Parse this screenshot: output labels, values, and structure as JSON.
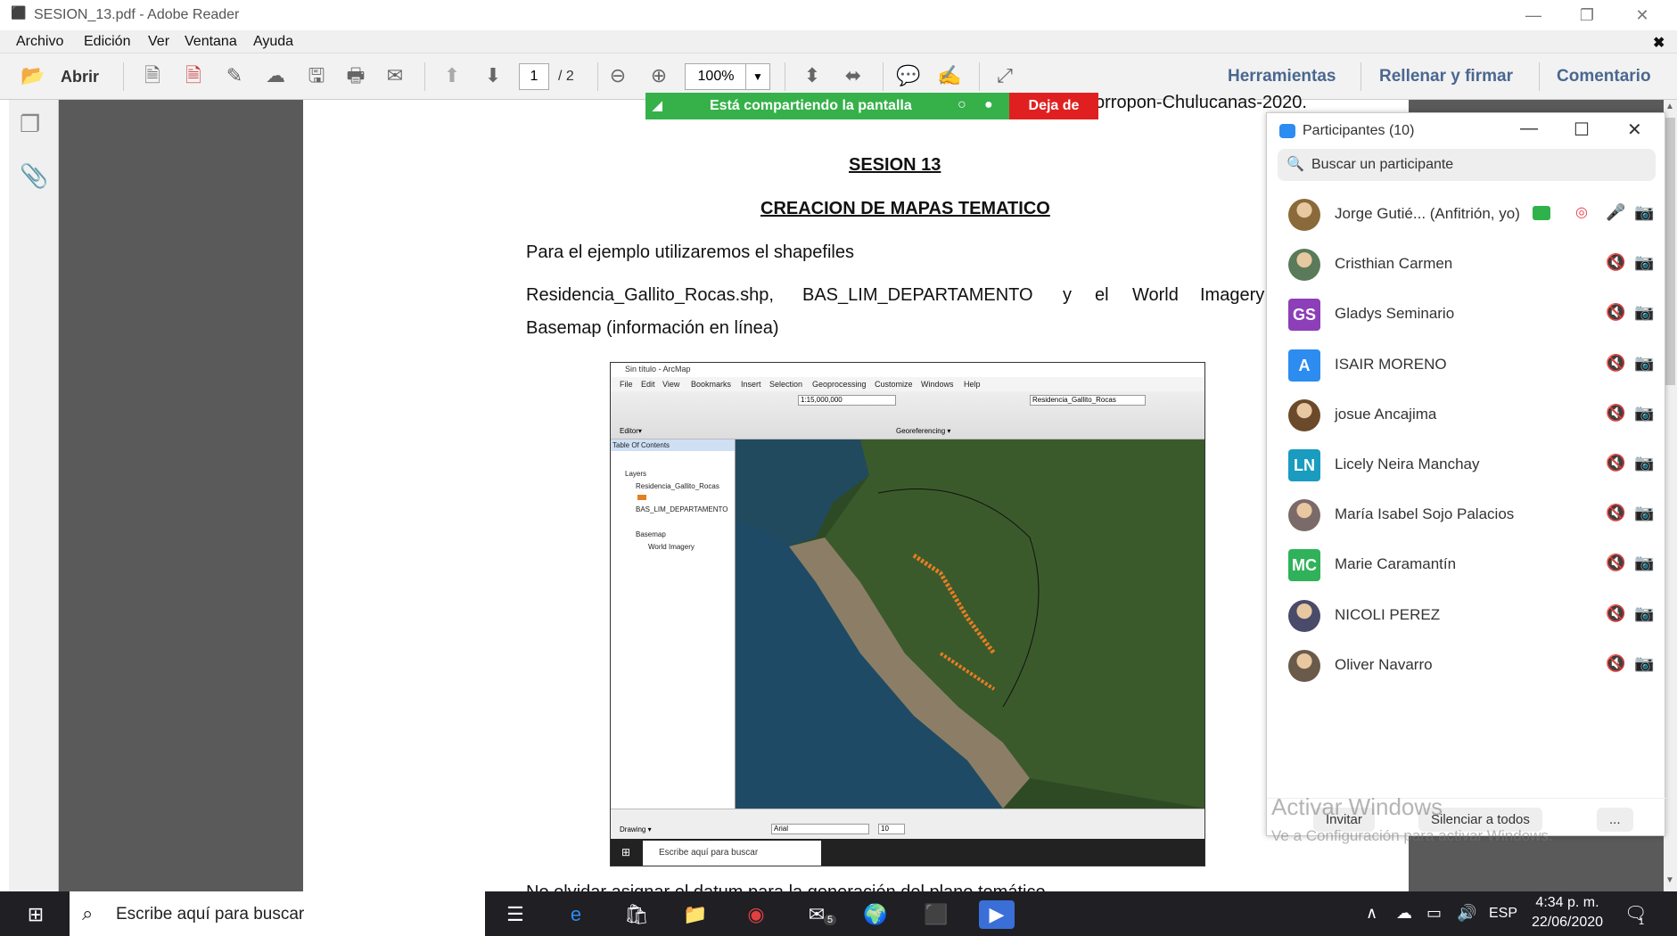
{
  "window": {
    "title": "SESION_13.pdf - Adobe Reader"
  },
  "menu": [
    "Archivo",
    "Edición",
    "Ver",
    "Ventana",
    "Ayuda"
  ],
  "toolbar": {
    "open_label": "Abrir",
    "page_current": "1",
    "page_total": "/ 2",
    "zoom": "100%",
    "links": [
      "Herramientas",
      "Rellenar y firmar",
      "Comentario"
    ]
  },
  "share": {
    "status": "Está compartiendo la pantalla",
    "stop": "Deja de"
  },
  "doc": {
    "header_cut": "orropon-Chulucanas-2020.",
    "title1": "SESION 13",
    "title2": "CREACION DE MAPAS TEMATICO",
    "p1": "Para el ejemplo utilizaremos el shapefiles",
    "p2a": "Residencia_Gallito_Rocas.shp,",
    "p2b": "BAS_LIM_DEPARTAMENTO",
    "p2c": "y",
    "p2d": "el",
    "p2e": "World",
    "p2f": "Imagery",
    "p3": "Basemap (información en línea)",
    "footer_cut": "No olvidar asignar el datum para la generación del plano temático"
  },
  "arcmap": {
    "title": "Sin título - ArcMap",
    "menu": [
      "File",
      "Edit",
      "View",
      "Bookmarks",
      "Insert",
      "Selection",
      "Geoprocessing",
      "Customize",
      "Windows",
      "Help"
    ],
    "scale": "1:15,000,000",
    "layer_dropdown": "Residencia_Gallito_Rocas",
    "editor": "Editor▾",
    "georef": "Georeferencing ▾",
    "toc_title": "Table Of Contents",
    "toc": [
      "Layers",
      "Residencia_Gallito_Rocas",
      "BAS_LIM_DEPARTAMENTO",
      "Basemap",
      "World Imagery"
    ],
    "drawing": "Drawing ▾",
    "font": "Arial",
    "font_size": "10",
    "taskbar_search": "Escribe aquí para buscar"
  },
  "zoom": {
    "title": "Participantes (10)",
    "search": "Buscar un participante",
    "participants": [
      {
        "name": "Jorge Gutié...  (Anfitrión, yo)",
        "initials": "",
        "color": "#8a6a3a"
      },
      {
        "name": "Cristhian Carmen",
        "initials": "",
        "color": "#5a7a5a"
      },
      {
        "name": "Gladys Seminario",
        "initials": "GS",
        "color": "#8c3fb8"
      },
      {
        "name": "ISAIR MORENO",
        "initials": "A",
        "color": "#2d8cf0"
      },
      {
        "name": "josue Ancajima",
        "initials": "",
        "color": "#6a4a2a"
      },
      {
        "name": "Licely Neira Manchay",
        "initials": "LN",
        "color": "#1a9bc0"
      },
      {
        "name": "María Isabel Sojo Palacios",
        "initials": "",
        "color": "#7a6a6a"
      },
      {
        "name": "Marie Caramantín",
        "initials": "MC",
        "color": "#2fb25a"
      },
      {
        "name": "NICOLI PEREZ",
        "initials": "",
        "color": "#4a4a6a"
      },
      {
        "name": "Oliver Navarro",
        "initials": "",
        "color": "#6a5a4a"
      }
    ],
    "invite": "Invitar",
    "mute_all": "Silenciar a todos",
    "more": "..."
  },
  "watermark": {
    "line1": "Activar Windows",
    "line2": "Ve a Configuración para activar Windows."
  },
  "taskbar": {
    "search": "Escribe aquí para buscar",
    "lang": "ESP",
    "time": "4:34 p. m.",
    "date": "22/06/2020",
    "mail_badge": "5",
    "notif_badge": "1"
  }
}
